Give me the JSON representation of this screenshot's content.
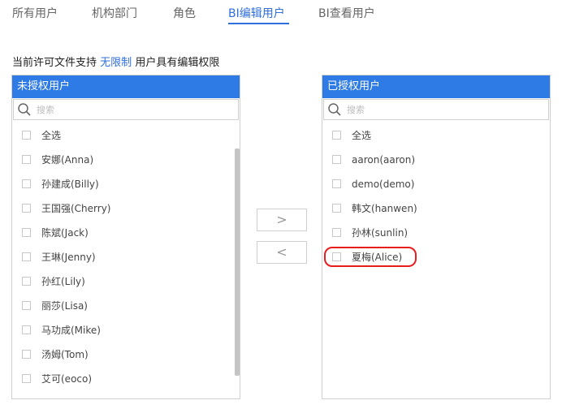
{
  "tabs": [
    {
      "label": "所有用户"
    },
    {
      "label": "机构部门"
    },
    {
      "label": "角色"
    },
    {
      "label": "BI编辑用户"
    },
    {
      "label": "BI查看用户"
    }
  ],
  "license": {
    "prefix": "当前许可文件支持",
    "highlight": "无限制",
    "suffix": "用户具有编辑权限"
  },
  "left_panel": {
    "title": "未授权用户",
    "search_placeholder": "搜索",
    "select_all": "全选",
    "items": [
      "安娜(Anna)",
      "孙建成(Billy)",
      "王国强(Cherry)",
      "陈斌(Jack)",
      "王琳(Jenny)",
      "孙红(Lily)",
      "丽莎(Lisa)",
      "马功成(Mike)",
      "汤姆(Tom)",
      "艾可(eoco)"
    ]
  },
  "right_panel": {
    "title": "已授权用户",
    "search_placeholder": "搜索",
    "select_all": "全选",
    "items": [
      "aaron(aaron)",
      "demo(demo)",
      "韩文(hanwen)",
      "孙林(sunlin)",
      "夏梅(Alice)"
    ]
  },
  "transfer": {
    "move_right": ">",
    "move_left": "<"
  },
  "colors": {
    "accent": "#2f7be5",
    "tab_active": "#2f6fde",
    "annotation": "#e81e1e"
  }
}
